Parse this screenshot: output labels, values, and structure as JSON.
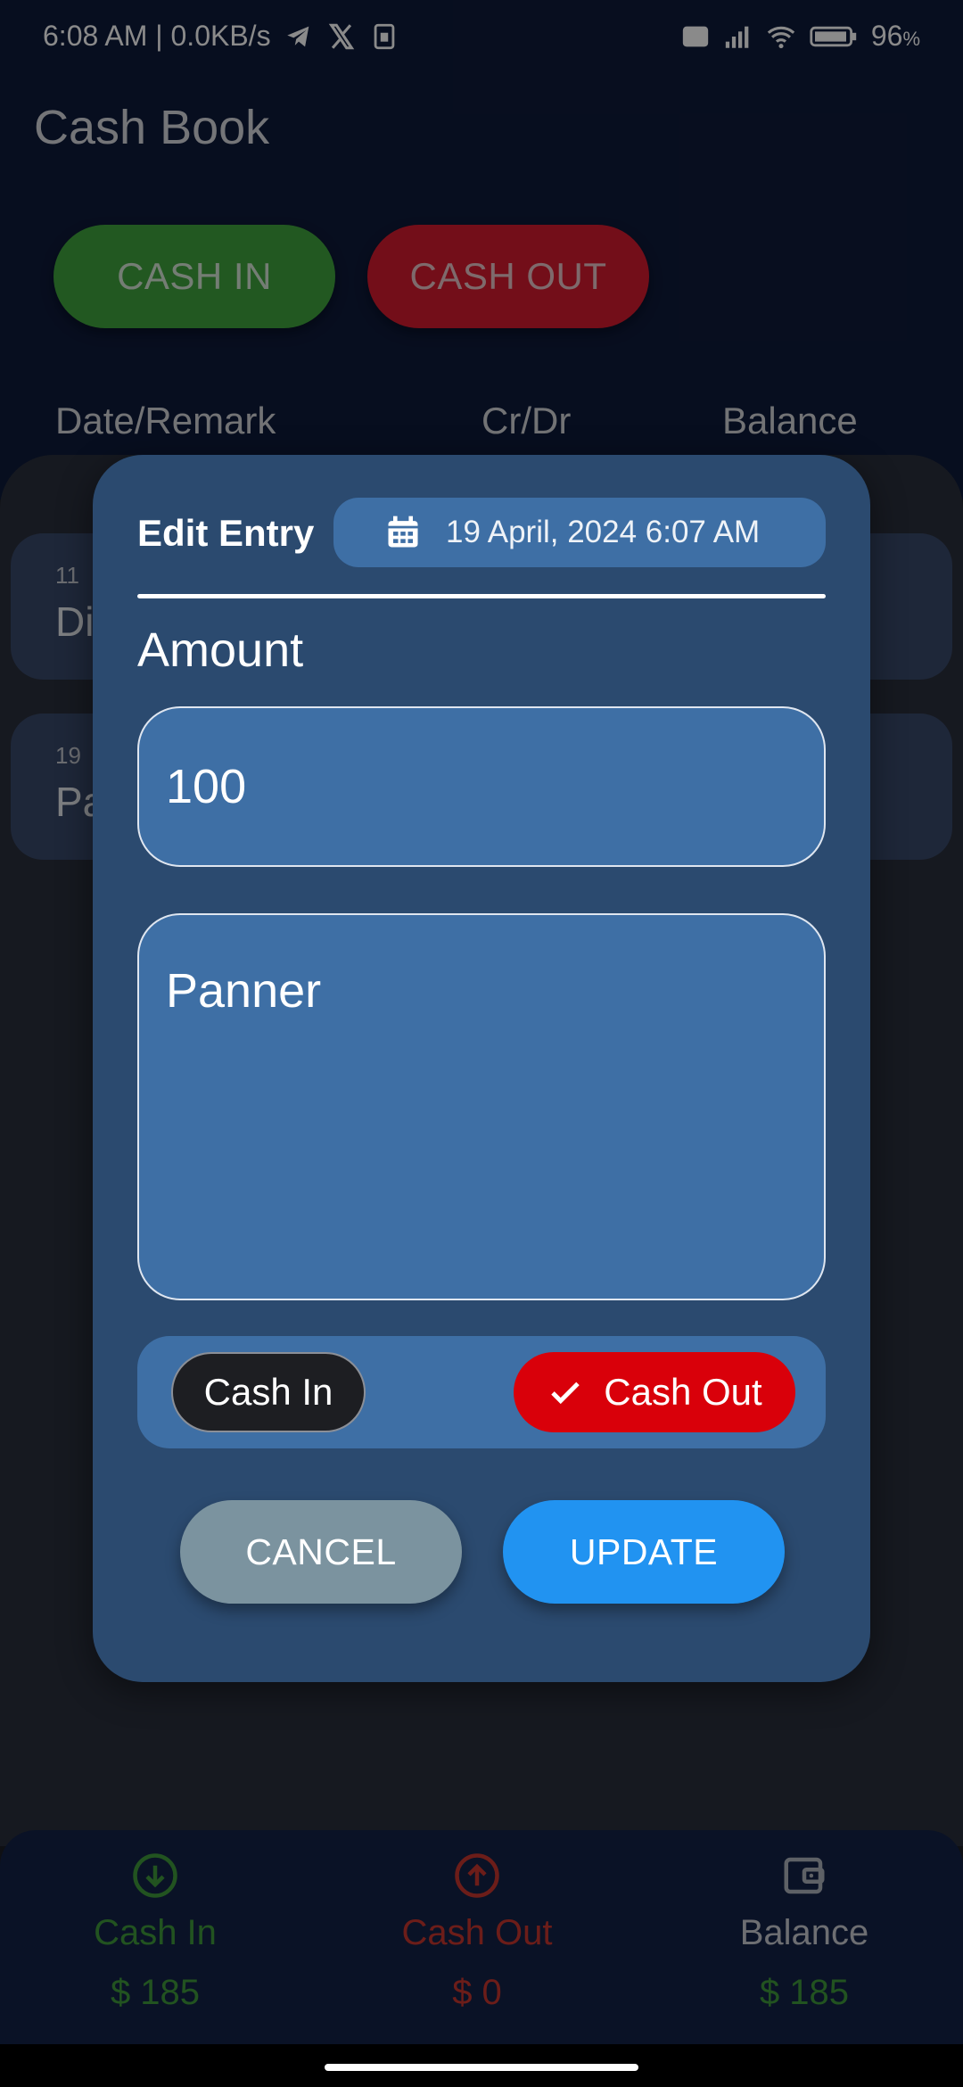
{
  "status_bar": {
    "time_speed": "6:08 AM | 0.0KB/s",
    "battery": "96",
    "battery_unit": "%"
  },
  "app": {
    "title": "Cash Book",
    "cash_in_button": "CASH IN",
    "cash_out_button": "CASH OUT",
    "columns": [
      "Date/Remark",
      "Cr/Dr",
      "Balance"
    ],
    "entries": [
      {
        "date": "11",
        "remark": "Di"
      },
      {
        "date": "19",
        "remark": "Pa"
      }
    ]
  },
  "bottom_nav": {
    "items": [
      {
        "label": "Cash In",
        "value": "$ 185",
        "color": "#3f9a3c",
        "icon": "arrow-down-circle-icon"
      },
      {
        "label": "Cash Out",
        "value": "$ 0",
        "color": "#c8372f",
        "icon": "arrow-up-circle-icon"
      },
      {
        "label": "Balance",
        "value": "$ 185",
        "color": "#3f9a3c",
        "icon": "wallet-icon"
      }
    ]
  },
  "dialog": {
    "title": "Edit Entry",
    "date": "19 April, 2024 6:07 AM",
    "amount_label": "Amount",
    "amount_value": "100",
    "remark_value": "Panner",
    "type_options": {
      "cash_in": "Cash In",
      "cash_out": "Cash Out"
    },
    "selected_type": "Cash Out",
    "cancel_label": "CANCEL",
    "update_label": "UPDATE"
  },
  "colors": {
    "dialog_bg": "#2b4a6f",
    "field_bg": "#3e6fa5",
    "cash_out_selected": "#d9000a",
    "update_button": "#2193f1",
    "cancel_button": "#7b939f"
  }
}
